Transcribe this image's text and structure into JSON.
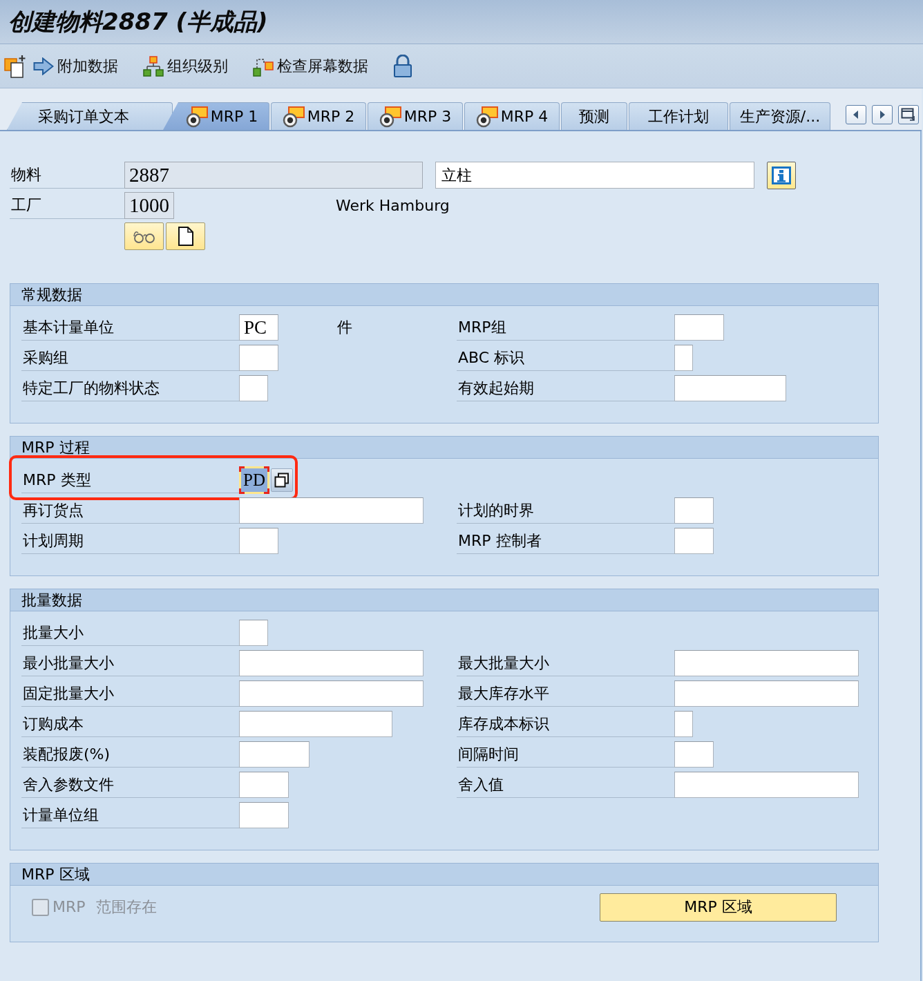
{
  "window": {
    "title": "创建物料2887 (半成品)"
  },
  "toolbar": {
    "buttons": [
      {
        "label": "附加数据"
      },
      {
        "label": "组织级别"
      },
      {
        "label": "检查屏幕数据"
      }
    ]
  },
  "tabs": [
    {
      "label": "采购订单文本",
      "kind": "text",
      "selected": false
    },
    {
      "label": "MRP 1",
      "kind": "icon",
      "selected": true
    },
    {
      "label": "MRP 2",
      "kind": "icon",
      "selected": false
    },
    {
      "label": "MRP 3",
      "kind": "icon",
      "selected": false
    },
    {
      "label": "MRP 4",
      "kind": "icon",
      "selected": false
    },
    {
      "label": "预测",
      "kind": "text",
      "selected": false
    },
    {
      "label": "工作计划",
      "kind": "text",
      "selected": false
    },
    {
      "label": "生产资源/...",
      "kind": "text",
      "selected": false
    }
  ],
  "header": {
    "material": {
      "label": "物料",
      "value": "2887",
      "editable": false,
      "description": "立柱"
    },
    "plant": {
      "label": "工厂",
      "value": "1000",
      "editable": false,
      "name": "Werk Hamburg"
    }
  },
  "sections": [
    {
      "title": "常规数据",
      "rows": [
        {
          "annotated": false,
          "left": {
            "label": "基本计量单位",
            "value": "PC",
            "unit": "件",
            "focused": false
          },
          "right": {
            "label": "MRP组",
            "focused": false
          }
        },
        {
          "annotated": false,
          "left": {
            "label": "采购组",
            "focused": false
          },
          "right": {
            "label": "ABC 标识",
            "focused": false
          }
        },
        {
          "annotated": false,
          "left": {
            "label": "特定工厂的物料状态",
            "focused": false
          },
          "right": {
            "label": "有效起始期",
            "focused": false
          }
        }
      ]
    },
    {
      "title": "MRP 过程",
      "rows": [
        {
          "annotated": true,
          "left": {
            "label": "MRP 类型",
            "value": "PD",
            "focused": true
          }
        },
        {
          "annotated": false,
          "left": {
            "label": "再订货点",
            "focused": false
          },
          "right": {
            "label": "计划的时界",
            "focused": false
          }
        },
        {
          "annotated": false,
          "left": {
            "label": "计划周期",
            "focused": false
          },
          "right": {
            "label": "MRP 控制者",
            "focused": false
          }
        }
      ]
    },
    {
      "title": "批量数据",
      "rows": [
        {
          "annotated": false,
          "left": {
            "label": "批量大小",
            "focused": false
          }
        },
        {
          "annotated": false,
          "left": {
            "label": "最小批量大小",
            "focused": false
          },
          "right": {
            "label": "最大批量大小",
            "focused": false
          }
        },
        {
          "annotated": false,
          "left": {
            "label": "固定批量大小",
            "focused": false
          },
          "right": {
            "label": "最大库存水平",
            "focused": false
          }
        },
        {
          "annotated": false,
          "left": {
            "label": "订购成本",
            "focused": false
          },
          "right": {
            "label": "库存成本标识",
            "focused": false
          }
        },
        {
          "annotated": false,
          "left": {
            "label": "装配报废(%)",
            "focused": false
          },
          "right": {
            "label": "间隔时间",
            "focused": false
          }
        },
        {
          "annotated": false,
          "left": {
            "label": "舍入参数文件",
            "focused": false
          },
          "right": {
            "label": "舍入值",
            "focused": false
          }
        },
        {
          "annotated": false,
          "left": {
            "label": "计量单位组",
            "focused": false
          }
        }
      ]
    }
  ],
  "mrp_area": {
    "title": "MRP 区域",
    "checkbox": {
      "label": "MRP 范围存在",
      "checked": false,
      "disabled": true
    },
    "button": {
      "label": "MRP 区域"
    }
  }
}
